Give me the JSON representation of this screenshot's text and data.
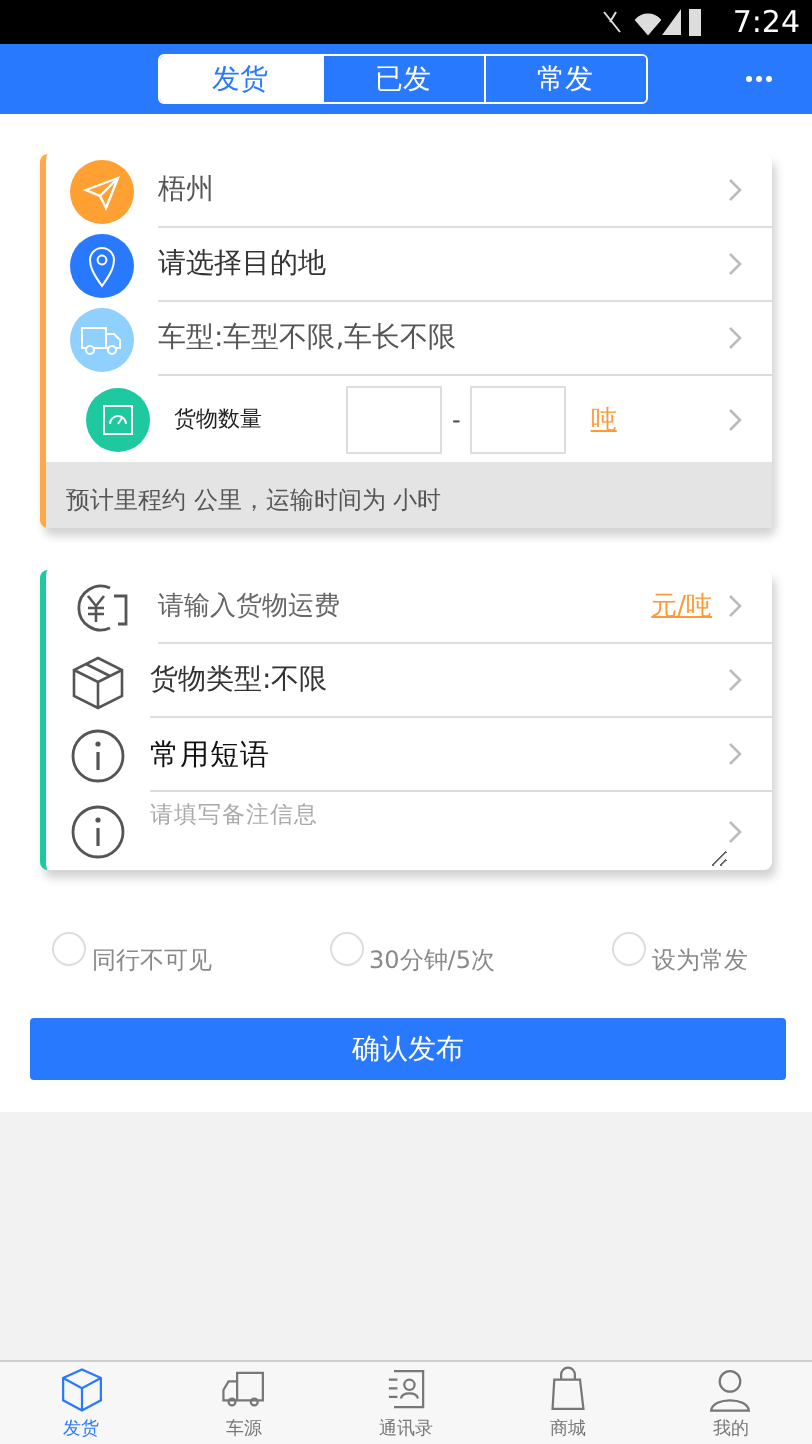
{
  "status_bar": {
    "time": "7:24"
  },
  "header": {
    "tabs": [
      {
        "label": "发货",
        "selected": true
      },
      {
        "label": "已发",
        "selected": false
      },
      {
        "label": "常发",
        "selected": false
      }
    ]
  },
  "route_card": {
    "rows": [
      {
        "kind": "origin",
        "text": "梧州"
      },
      {
        "kind": "destination",
        "text": "请选择目的地"
      },
      {
        "kind": "vehicle",
        "text": "车型:车型不限,车长不限"
      }
    ],
    "quantity": {
      "label": "货物数量",
      "separator": "-",
      "unit": "吨"
    },
    "estimate": "预计里程约 公里，运输时间为 小时"
  },
  "cargo_card": {
    "rows": [
      {
        "kind": "freight",
        "placeholder": "请输入货物运费",
        "unit": "元/吨"
      },
      {
        "kind": "type",
        "text": "货物类型:不限"
      },
      {
        "kind": "phrases",
        "text": "常用短语"
      },
      {
        "kind": "remark",
        "placeholder": "请填写备注信息"
      }
    ]
  },
  "options": [
    {
      "label": "同行不可见",
      "checked": false
    },
    {
      "label": "30分钟/5次",
      "checked": false
    },
    {
      "label": "设为常发",
      "checked": false
    }
  ],
  "submit": "确认发布",
  "bottom_nav": [
    {
      "label": "发货",
      "selected": true
    },
    {
      "label": "车源",
      "selected": false
    },
    {
      "label": "通讯录",
      "selected": false
    },
    {
      "label": "商城",
      "selected": false
    },
    {
      "label": "我的",
      "selected": false
    }
  ]
}
